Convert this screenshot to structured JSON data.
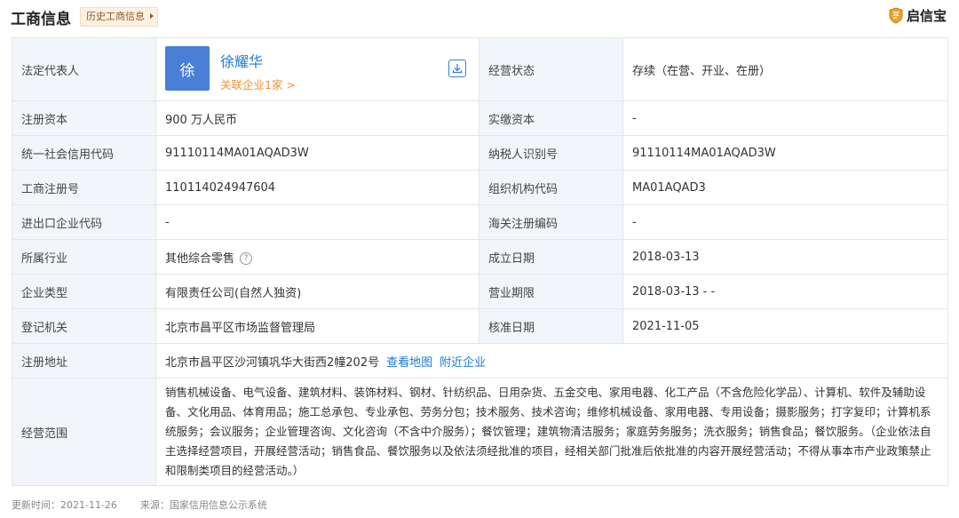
{
  "header": {
    "title": "工商信息",
    "history_button": "历史工商信息",
    "brand": "启信宝",
    "colors": {
      "accent": "#1c79d8",
      "orange": "#f29335",
      "label_bg": "#f2f5f9"
    }
  },
  "rep": {
    "label": "法定代表人",
    "avatar_char": "徐",
    "name": "徐耀华",
    "related": "关联企业1家 >",
    "icon": "download-icon"
  },
  "rows": [
    {
      "l1": "经营状态",
      "v1": "存续（在营、开业、在册）"
    },
    {
      "l1": "注册资本",
      "v1": "900 万人民币",
      "l2": "实缴资本",
      "v2": "-"
    },
    {
      "l1": "统一社会信用代码",
      "v1": "91110114MA01AQAD3W",
      "l2": "纳税人识别号",
      "v2": "91110114MA01AQAD3W"
    },
    {
      "l1": "工商注册号",
      "v1": "110114024947604",
      "l2": "组织机构代码",
      "v2": "MA01AQAD3"
    },
    {
      "l1": "进出口企业代码",
      "v1": "-",
      "l2": "海关注册编码",
      "v2": "-"
    },
    {
      "l1": "所属行业",
      "v1": "其他综合零售",
      "help": "?",
      "l2": "成立日期",
      "v2": "2018-03-13"
    },
    {
      "l1": "企业类型",
      "v1": "有限责任公司(自然人独资)",
      "l2": "营业期限",
      "v2": "2018-03-13 - -"
    },
    {
      "l1": "登记机关",
      "v1": "北京市昌平区市场监督管理局",
      "l2": "核准日期",
      "v2": "2021-11-05"
    }
  ],
  "address": {
    "label": "注册地址",
    "value": "北京市昌平区沙河镇巩华大街西2幢202号",
    "map_link": "查看地图",
    "nearby_link": "附近企业"
  },
  "scope": {
    "label": "经营范围",
    "text": "销售机械设备、电气设备、建筑材料、装饰材料、钢材、针纺织品、日用杂货、五金交电、家用电器、化工产品（不含危险化学品）、计算机、软件及辅助设备、文化用品、体育用品；施工总承包、专业承包、劳务分包；技术服务、技术咨询；维修机械设备、家用电器、专用设备；摄影服务；打字复印；计算机系统服务；会议服务；企业管理咨询、文化咨询（不含中介服务）；餐饮管理；建筑物清洁服务；家庭劳务服务；洗衣服务；销售食品；餐饮服务。（企业依法自主选择经营项目，开展经营活动；销售食品、餐饮服务以及依法须经批准的项目，经相关部门批准后依批准的内容开展经营活动；不得从事本市产业政策禁止和限制类项目的经营活动。）"
  },
  "footer": {
    "updated": "更新时间：2021-11-26",
    "source": "来源：国家信用信息公示系统"
  }
}
